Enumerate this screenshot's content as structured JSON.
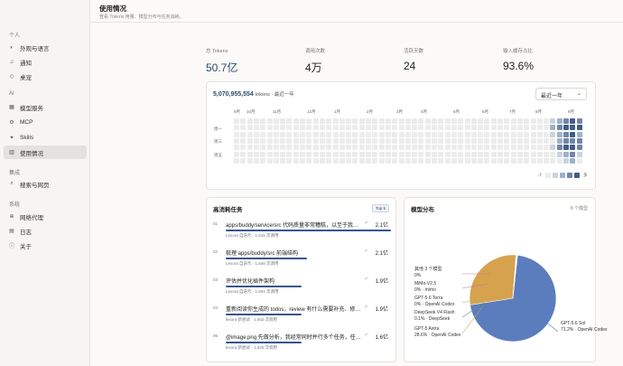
{
  "sidebar": {
    "sections": [
      {
        "label": "个人",
        "items": [
          {
            "label": "外观与语言",
            "icon": "appearance-icon"
          },
          {
            "label": "通知",
            "icon": "bell-icon"
          },
          {
            "label": "桌宠",
            "icon": "pet-icon"
          }
        ]
      },
      {
        "label": "AI",
        "items": [
          {
            "label": "模型服务",
            "icon": "model-icon"
          },
          {
            "label": "MCP",
            "icon": "mcp-icon"
          },
          {
            "label": "Skills",
            "icon": "skills-icon"
          },
          {
            "label": "使用情况",
            "icon": "usage-icon",
            "active": true
          }
        ]
      },
      {
        "label": "集成",
        "items": [
          {
            "label": "搜索与网页",
            "icon": "search-web-icon"
          }
        ]
      },
      {
        "label": "系统",
        "items": [
          {
            "label": "网络代理",
            "icon": "proxy-icon"
          },
          {
            "label": "日志",
            "icon": "log-icon"
          },
          {
            "label": "关于",
            "icon": "info-icon"
          }
        ]
      }
    ]
  },
  "header": {
    "title": "使用情况",
    "subtitle": "查看 Tokens 用量、模型分布与任务消耗。"
  },
  "stats": [
    {
      "label": "总 Tokens",
      "value": "50.7亿",
      "accent": true
    },
    {
      "label": "调用次数",
      "value": "4万"
    },
    {
      "label": "活跃天数",
      "value": "24"
    },
    {
      "label": "输入缓存占比",
      "value": "93.6%"
    }
  ],
  "heatmap": {
    "total": "5,070,955,554",
    "total_suffix": "tokens · 最近一年",
    "range_label": "最近一年",
    "months": [
      "9月",
      "10月",
      "11月",
      "12月",
      "1月",
      "2月",
      "3月",
      "4月",
      "5月",
      "6月",
      "7月",
      "8月",
      "9月"
    ],
    "day_labels": [
      "周一",
      "周三",
      "周五"
    ],
    "legend_less": "少",
    "legend_more": "多",
    "colors": [
      "#ececec",
      "#c9d3e0",
      "#9fb0c8",
      "#6f86a8",
      "#435e86"
    ],
    "levels": [
      [
        1,
        2,
        1,
        0,
        1,
        0,
        0
      ],
      [
        2,
        3,
        2,
        2,
        3,
        1,
        0
      ],
      [
        3,
        4,
        3,
        3,
        4,
        2,
        1
      ],
      [
        4,
        4,
        4,
        3,
        4,
        3,
        2
      ],
      [
        3,
        4,
        2,
        3,
        3,
        1,
        0
      ]
    ]
  },
  "tasks": {
    "title": "高消耗任务",
    "badge": "Top 5",
    "items": [
      {
        "num": "01",
        "text": "apps/buddy/service/src 代码质量非常糟糕，以至于我想要…",
        "value": "2.1亿",
        "meta": "Lexora 自迭代 · 1,615 次调用",
        "fraction": 1.0
      },
      {
        "num": "02",
        "text": "梳理 apps/buddy/src 前端结构",
        "value": "2.1亿",
        "meta": "Lexora 自迭代 · 1,648 次调用",
        "fraction": 0.49
      },
      {
        "num": "03",
        "text": "评估并优化插件架构",
        "value": "1.9亿",
        "meta": "Lexora 自迭代 · 1,504 次调用",
        "fraction": 0.46
      },
      {
        "num": "04",
        "text": "重新阅读你生成的 todos，review 有什么需要补充、修改的吗…",
        "value": "1.9亿",
        "meta": "lexora 新尝试 · 1,402 次调用",
        "fraction": 0.46
      },
      {
        "num": "05",
        "text": "@image.png 先做分析，我经常同时并行多个任务，任务完成…",
        "value": "1.6亿",
        "meta": "lexora 新尝试 · 1,325 次调用",
        "fraction": 0.46
      }
    ]
  },
  "models": {
    "title": "模型分布",
    "count_label": "8 个模型",
    "chart_data": {
      "type": "pie",
      "slices": [
        {
          "name": "GPT-5.6 Sol",
          "pct": 71.2,
          "vendor": "OpenAI Codex",
          "color": "#5b7dbd"
        },
        {
          "name": "GPT-5 Astra",
          "pct": 28.6,
          "vendor": "OpenAI Codex",
          "color": "#d7a24e"
        },
        {
          "name": "DeepSeek V4 Flash",
          "pct": 0.1,
          "vendor": "DeepSeek",
          "color": "#4f9d8b"
        },
        {
          "name": "GPT-5.6 Terra",
          "pct": 0.0,
          "vendor": "OpenAI Codex",
          "color": "#a0c05a"
        },
        {
          "name": "MiMo-V2.5",
          "pct": 0.0,
          "vendor": "mimo",
          "color": "#b86fb0"
        },
        {
          "name": "其他 3 个模型",
          "pct": 0.0,
          "vendor": "",
          "color": "#d9757a"
        }
      ]
    },
    "labels": [
      {
        "line1": "其他 3 个模型",
        "line2": "0%"
      },
      {
        "line1": "MiMo-V2.5",
        "line2": "0% · mimo"
      },
      {
        "line1": "GPT-5.6 Terra",
        "line2": "0% · OpenAI Codex"
      },
      {
        "line1": "DeepSeek V4 Flash",
        "line2": "0.1% · DeepSeek"
      },
      {
        "line1": "GPT-5 Astra",
        "line2": "28.6% · OpenAI Codex"
      },
      {
        "line1": "GPT-5.6 Sol",
        "line2": "71.2% · OpenAI Codex"
      }
    ]
  }
}
